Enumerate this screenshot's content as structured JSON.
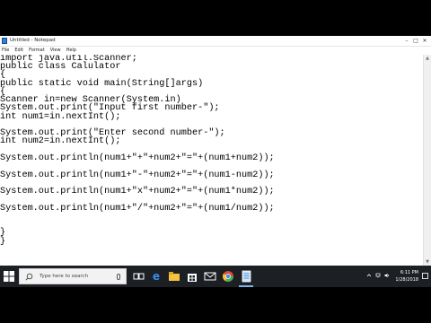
{
  "window": {
    "title": "Untitled - Notepad",
    "controls": {
      "minimize": "–",
      "maximize": "□",
      "close": "✕"
    }
  },
  "menu": [
    "File",
    "Edit",
    "Format",
    "View",
    "Help"
  ],
  "code_lines": [
    "import java.util.Scanner;",
    "public class Calulator",
    "{",
    "public static void main(String[]args)",
    "{",
    "Scanner in=new Scanner(System.in)",
    "System.out.print(\"Input first number-\");",
    "int num1=in.nextInt();",
    "",
    "System.out.print(\"Enter second number-\");",
    "int num2=in.nextInt();",
    "",
    "System.out.println(num1+\"+\"+num2+\"=\"+(num1+num2));",
    "",
    "System.out.println(num1+\"-\"+num2+\"=\"+(num1-num2));",
    "",
    "System.out.println(num1+\"x\"+num2+\"=\"+(num1*num2));",
    "",
    "System.out.println(num1+\"/\"+num2+\"=\"+(num1/num2));",
    "",
    "",
    "}",
    "}"
  ],
  "taskbar": {
    "search_placeholder": "Type here to search",
    "clock_time": "6:11 PM",
    "clock_date": "1/28/2018",
    "icons": [
      "windows-start-icon",
      "task-view-icon",
      "edge-icon",
      "file-explorer-icon",
      "store-icon",
      "mail-icon",
      "chrome-icon",
      "notepad-icon"
    ]
  },
  "colors": {
    "taskbar": "#1c1f24",
    "accent": "#2f7fd8"
  }
}
